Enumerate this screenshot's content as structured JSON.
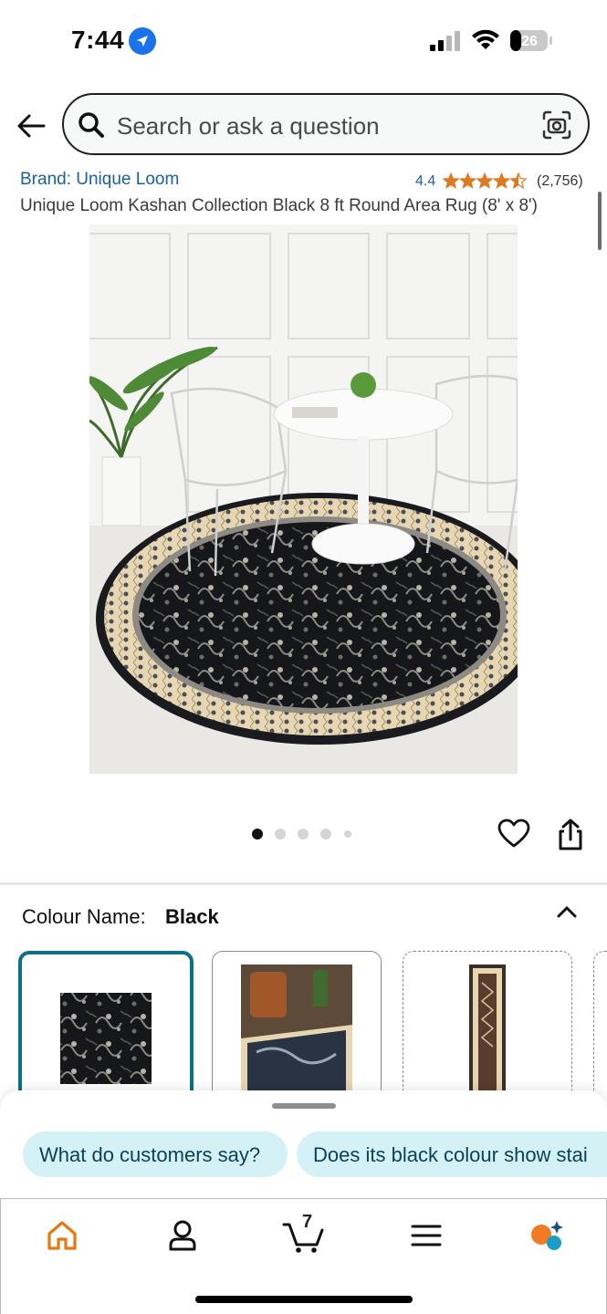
{
  "status_bar": {
    "time": "7:44",
    "battery": "26"
  },
  "search": {
    "placeholder": "Search or ask a question"
  },
  "product": {
    "brand": "Brand: Unique Loom",
    "rating": "4.4",
    "rating_value": 4.4,
    "rating_count": "(2,756)",
    "title": "Unique Loom Kashan Collection Black 8 ft Round Area Rug (8' x 8')"
  },
  "carousel": {
    "total": 5,
    "active": 1
  },
  "colour": {
    "label": "Colour Name:",
    "value": "Black"
  },
  "suggestions": [
    "What do customers say?",
    "Does its black colour show stai"
  ],
  "nav": {
    "cart_count": "7"
  },
  "colors": {
    "link": "#1a5f9e",
    "star": "#de7921",
    "accent": "#0b7185",
    "chip_bg": "#d4f2f5",
    "home": "#e47911"
  },
  "icons": [
    "back-arrow-icon",
    "search-icon",
    "camera-icon",
    "heart-icon",
    "share-icon",
    "chevron-up-icon",
    "home-icon",
    "profile-icon",
    "cart-icon",
    "menu-icon",
    "rufus-icon"
  ]
}
